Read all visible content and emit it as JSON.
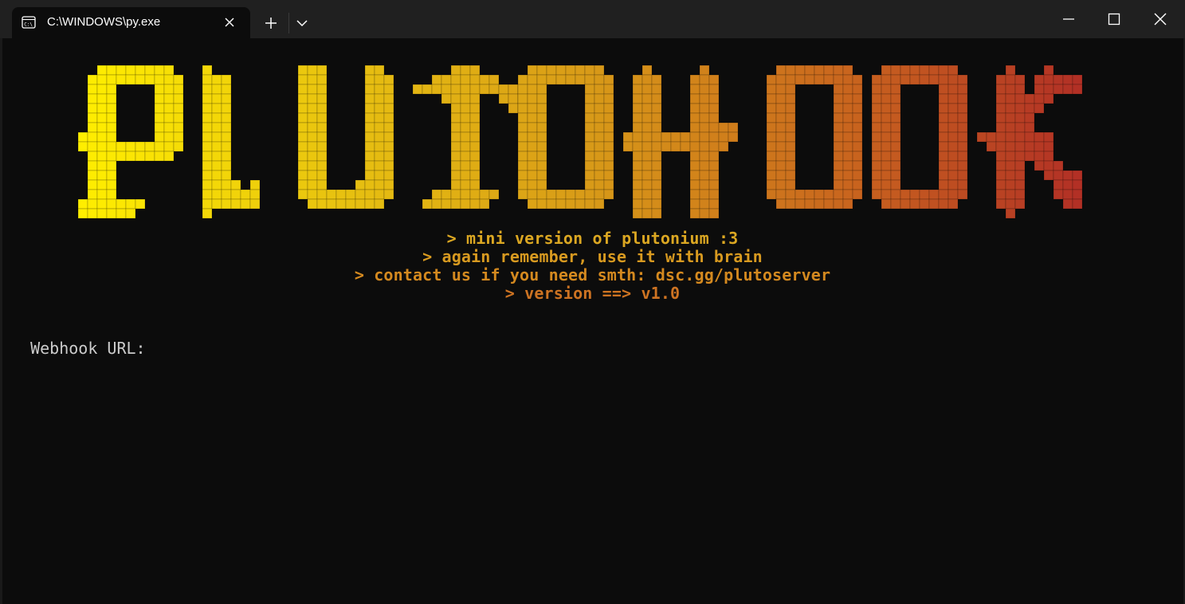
{
  "window": {
    "tab_title": "C:\\WINDOWS\\py.exe",
    "tab_icon": "terminal-icon",
    "controls": [
      "minimize-icon",
      "maximize-icon",
      "close-icon"
    ],
    "new_tab_icon": "plus-icon",
    "dropdown_icon": "chevron-down-icon"
  },
  "banner": {
    "text": "PLUTOHOOK",
    "gradient_colors": [
      "#ffee00",
      "#e8c210",
      "#d89a18",
      "#c9661e",
      "#b02c26"
    ]
  },
  "info_lines": [
    {
      "text": "> mini version of plutonium :3",
      "color": "#dba722"
    },
    {
      "text": "> again remember, use it with brain",
      "color": "#d89a20"
    },
    {
      "text": "> contact us if you need smth: dsc.gg/plutoserver",
      "color": "#d4891f"
    },
    {
      "text": "> version ==> v1.0",
      "color": "#cd7322"
    }
  ],
  "prompt": {
    "label": "Webhook URL:",
    "value": ""
  }
}
